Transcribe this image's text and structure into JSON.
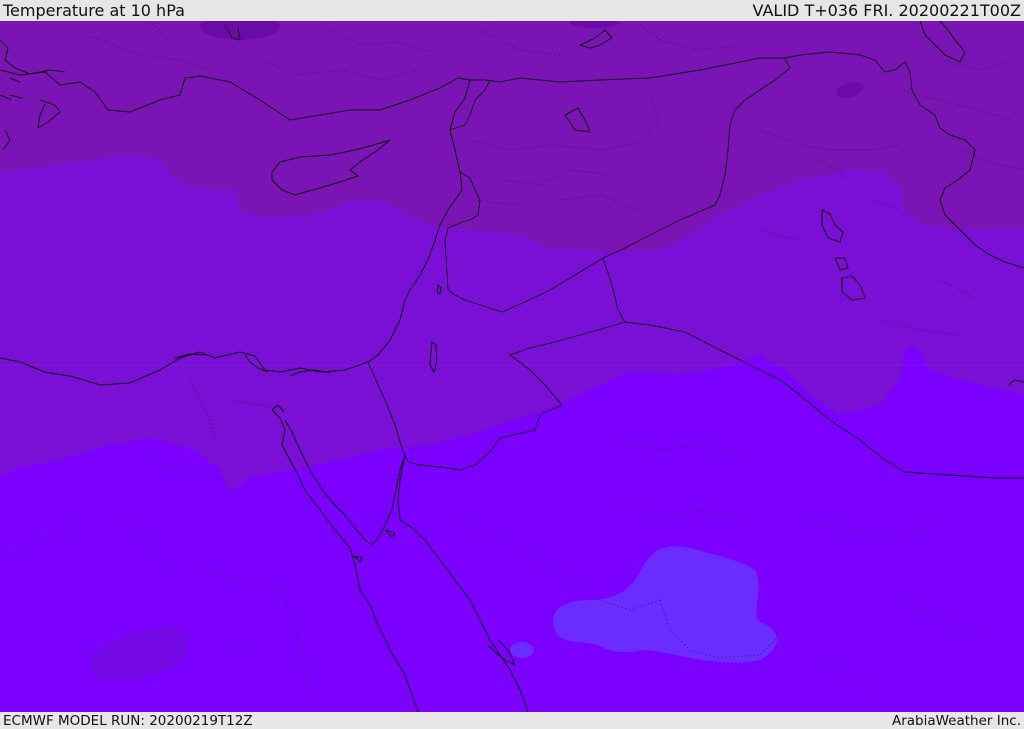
{
  "header": {
    "title": "Temperature at 10 hPa",
    "valid": "VALID T+036 FRI. 20200221T00Z"
  },
  "footer": {
    "model_run": "ECMWF MODEL RUN: 20200219T12Z",
    "credit": "ArabiaWeather Inc."
  },
  "colors": {
    "band_cold": "#7a14b4",
    "band_mid": "#7a0fd6",
    "band_warm": "#7b00ff",
    "patch_dark": "#6a0aa8",
    "patch_blue": "#6a2cff",
    "patch_violet": "#7408e4"
  }
}
